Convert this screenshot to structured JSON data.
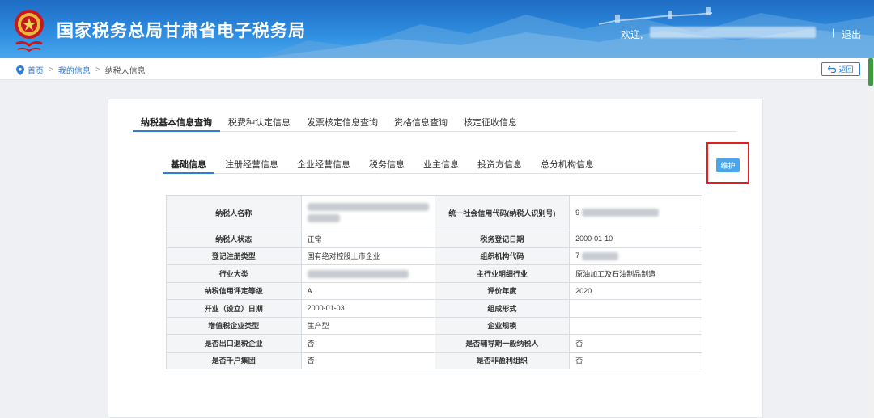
{
  "header": {
    "title": "国家税务总局甘肃省电子税务局",
    "welcome": "欢迎,",
    "divider": "|",
    "logout": "退出"
  },
  "breadcrumb": {
    "items": [
      "首页",
      "我的信息",
      "纳税人信息"
    ],
    "back": "返回"
  },
  "tabs_primary": [
    "纳税基本信息查询",
    "税费种认定信息",
    "发票核定信息查询",
    "资格信息查询",
    "核定征收信息"
  ],
  "tabs_secondary": [
    "基础信息",
    "注册经营信息",
    "企业经营信息",
    "税务信息",
    "业主信息",
    "投资方信息",
    "总分机构信息"
  ],
  "maintain_button": "维护",
  "table": {
    "rows": [
      {
        "l1": "纳税人名称",
        "v1": "",
        "l2": "统一社会信用代码(纳税人识别号)",
        "v2": "9"
      },
      {
        "l1": "纳税人状态",
        "v1": "正常",
        "l2": "税务登记日期",
        "v2": "2000-01-10"
      },
      {
        "l1": "登记注册类型",
        "v1": "国有绝对控股上市企业",
        "l2": "组织机构代码",
        "v2": "7"
      },
      {
        "l1": "行业大类",
        "v1": "",
        "l2": "主行业明细行业",
        "v2": "原油加工及石油制品制造"
      },
      {
        "l1": "纳税信用评定等级",
        "v1": "A",
        "l2": "评价年度",
        "v2": "2020"
      },
      {
        "l1": "开业（设立）日期",
        "v1": "2000-01-03",
        "l2": "组成形式",
        "v2": ""
      },
      {
        "l1": "增值税企业类型",
        "v1": "生产型",
        "l2": "企业规模",
        "v2": ""
      },
      {
        "l1": "是否出口退税企业",
        "v1": "否",
        "l2": "是否辅导期一般纳税人",
        "v2": "否"
      },
      {
        "l1": "是否千户集团",
        "v1": "否",
        "l2": "是否非盈利组织",
        "v2": "否"
      }
    ]
  },
  "colors": {
    "accent": "#2d7ed8",
    "header_gradient_top": "#1f6cc4",
    "highlight_box": "#e02020",
    "maintain_button": "#4aa6e6"
  }
}
